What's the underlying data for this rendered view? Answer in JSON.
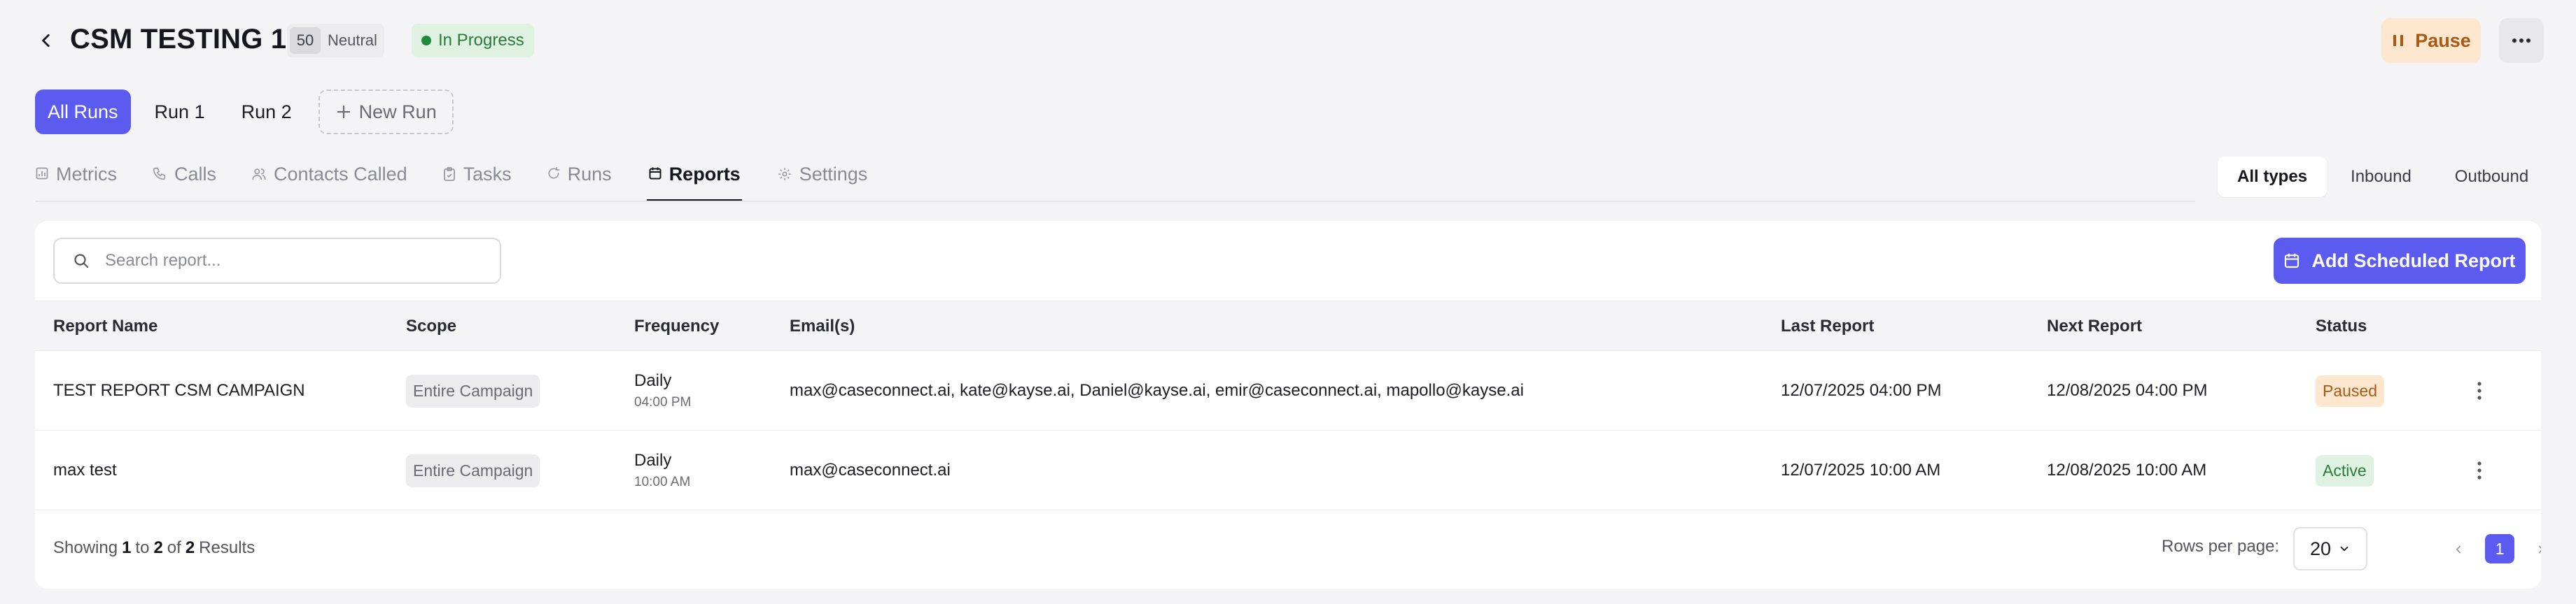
{
  "header": {
    "title": "CSM TESTING 1",
    "score": "50",
    "sentiment": "Neutral",
    "status": "In Progress",
    "pause_label": "Pause"
  },
  "runs": {
    "tabs": [
      "All Runs",
      "Run 1",
      "Run 2"
    ],
    "new_run_label": "New Run",
    "active_index": 0
  },
  "sections": {
    "tabs": [
      {
        "label": "Metrics",
        "icon": "metrics-icon"
      },
      {
        "label": "Calls",
        "icon": "phone-icon"
      },
      {
        "label": "Contacts Called",
        "icon": "contacts-icon"
      },
      {
        "label": "Tasks",
        "icon": "clipboard-icon"
      },
      {
        "label": "Runs",
        "icon": "refresh-icon"
      },
      {
        "label": "Reports",
        "icon": "calendar-icon"
      },
      {
        "label": "Settings",
        "icon": "gear-icon"
      }
    ],
    "active": "Reports"
  },
  "type_filter": {
    "options": [
      "All types",
      "Inbound",
      "Outbound"
    ],
    "active": "All types"
  },
  "search": {
    "placeholder": "Search report..."
  },
  "add_button_label": "Add Scheduled Report",
  "table": {
    "columns": [
      "Report Name",
      "Scope",
      "Frequency",
      "Email(s)",
      "Last Report",
      "Next Report",
      "Status"
    ],
    "rows": [
      {
        "name": "TEST REPORT CSM CAMPAIGN",
        "scope": "Entire Campaign",
        "frequency": "Daily",
        "time": "04:00 PM",
        "emails": "max@caseconnect.ai, kate@kayse.ai, Daniel@kayse.ai, emir@caseconnect.ai, mapollo@kayse.ai",
        "last_report": "12/07/2025 04:00 PM",
        "next_report": "12/08/2025 04:00 PM",
        "status": "Paused"
      },
      {
        "name": "max test",
        "scope": "Entire Campaign",
        "frequency": "Daily",
        "time": "10:00 AM",
        "emails": "max@caseconnect.ai",
        "last_report": "12/07/2025 10:00 AM",
        "next_report": "12/08/2025 10:00 AM",
        "status": "Active"
      }
    ]
  },
  "footer": {
    "showing_prefix": "Showing",
    "from": "1",
    "to_word": "to",
    "to": "2",
    "of_word": "of",
    "total": "2",
    "results_word": "Results",
    "rows_per_page_label": "Rows per page:",
    "rows_per_page": "20",
    "current_page": "1"
  },
  "colors": {
    "accent": "#5b5bf0",
    "paused_bg": "#fde7cf",
    "paused_text": "#a85a14",
    "active_bg": "#dff2e2",
    "active_text": "#2c7a3c"
  }
}
